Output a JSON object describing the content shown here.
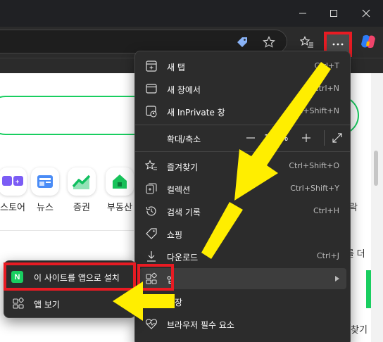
{
  "window": {
    "minimize_icon": "minimize-icon",
    "maximize_icon": "maximize-icon",
    "close_icon": "close-icon"
  },
  "toolbar": {
    "icons": [
      "tag-icon",
      "favorite-star-icon",
      "favorites-icon",
      "more-icon",
      "copilot-icon"
    ]
  },
  "page": {
    "services": [
      {
        "label": "스토어",
        "icon": "store-icon"
      },
      {
        "label": "뉴스",
        "icon": "news-icon"
      },
      {
        "label": "증권",
        "icon": "stocks-icon"
      },
      {
        "label": "부동산",
        "icon": "real-estate-icon"
      }
    ],
    "right_fragments": [
      "락",
      "를 더",
      "찾기"
    ],
    "brand_color": "#19ce60"
  },
  "menu": {
    "items": [
      {
        "label": "새 탭",
        "shortcut": "Ctrl+T",
        "icon": "new-tab-icon"
      },
      {
        "label": "새 창에서",
        "shortcut": "Ctrl+N",
        "icon": "new-window-icon"
      },
      {
        "label": "새 InPrivate 창",
        "shortcut": "Ctrl+Shift+N",
        "icon": "inprivate-icon"
      },
      {
        "label": "확대/축소",
        "shortcut": "",
        "icon": ""
      },
      {
        "label": "즐겨찾기",
        "shortcut": "Ctrl+Shift+O",
        "icon": "favorites-icon"
      },
      {
        "label": "컬렉션",
        "shortcut": "Ctrl+Shift+Y",
        "icon": "collections-icon"
      },
      {
        "label": "검색 기록",
        "shortcut": "Ctrl+H",
        "icon": "history-icon"
      },
      {
        "label": "쇼핑",
        "shortcut": "",
        "icon": "shopping-icon"
      },
      {
        "label": "다운로드",
        "shortcut": "Ctrl+J",
        "icon": "download-icon"
      },
      {
        "label": "앱",
        "shortcut": "",
        "icon": "apps-icon"
      },
      {
        "label": "확장",
        "shortcut": "",
        "icon": "extensions-icon"
      },
      {
        "label": "브라우저 필수 요소",
        "shortcut": "",
        "icon": "heart-pulse-icon"
      }
    ],
    "zoom_value": "100%",
    "submenu_arrow": "chevron-right-icon"
  },
  "submenu": {
    "items": [
      {
        "label": "이 사이트를 앱으로 설치",
        "icon": "n-logo-icon",
        "icon_text": "N"
      },
      {
        "label": "앱 보기",
        "icon": "apps-grid-icon"
      }
    ]
  },
  "annotation_colors": {
    "highlight": "#e81b23",
    "arrow": "#ffee00"
  }
}
